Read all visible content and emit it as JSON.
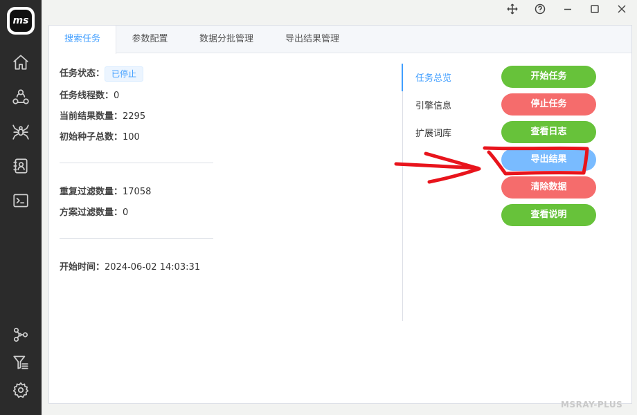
{
  "app": {
    "logo_text": "ms",
    "watermark": "MSRAY-PLUS"
  },
  "sidebar": {
    "icons": [
      "home-icon",
      "share-icon",
      "spider-icon",
      "contacts-icon",
      "terminal-icon",
      "graph-icon",
      "filter-list-icon",
      "gear-icon"
    ]
  },
  "window_controls": [
    "move-icon",
    "help-icon",
    "minimize-icon",
    "maximize-icon",
    "close-icon"
  ],
  "tabs": [
    {
      "label": "搜索任务",
      "active": true
    },
    {
      "label": "参数配置",
      "active": false
    },
    {
      "label": "数据分批管理",
      "active": false
    },
    {
      "label": "导出结果管理",
      "active": false
    }
  ],
  "info": {
    "status_label": "任务状态：",
    "status_value": "已停止",
    "threads_label": "任务线程数：",
    "threads_value": "0",
    "results_label": "当前结果数量：",
    "results_value": "2295",
    "seeds_label": "初始种子总数：",
    "seeds_value": "100",
    "dup_label": "重复过滤数量：",
    "dup_value": "17058",
    "plan_label": "方案过滤数量：",
    "plan_value": "0",
    "start_label": "开始时间：",
    "start_value": "2024-06-02 14:03:31"
  },
  "side_tabs": [
    {
      "label": "任务总览",
      "active": true
    },
    {
      "label": "引擎信息",
      "active": false
    },
    {
      "label": "扩展词库",
      "active": false
    }
  ],
  "buttons": {
    "start": "开始任务",
    "stop": "停止任务",
    "log": "查看日志",
    "export": "导出结果",
    "clear": "清除数据",
    "help": "查看说明"
  },
  "colors": {
    "accent": "#409eff",
    "green": "#67c23a",
    "red": "#f56c6c",
    "light_blue": "#79bbff",
    "annotation": "#e8141c"
  }
}
